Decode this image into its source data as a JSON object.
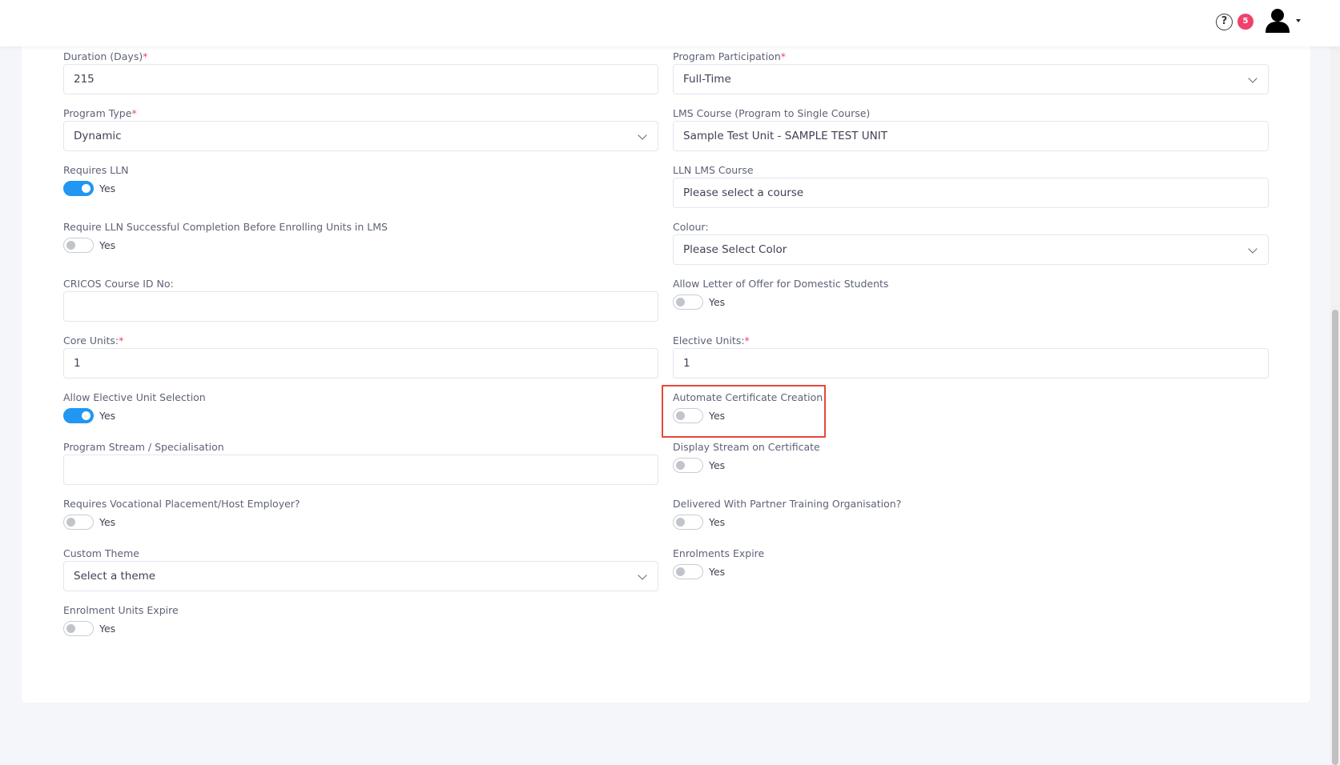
{
  "topbar": {
    "help_icon": "question-circle-icon",
    "notification_count": "5",
    "avatar_icon": "user-icon"
  },
  "form": {
    "duration": {
      "label": "Duration (Days)",
      "required": "*",
      "value": "215"
    },
    "program_participation": {
      "label": "Program Participation",
      "required": "*",
      "value": "Full-Time"
    },
    "program_type": {
      "label": "Program Type",
      "required": "*",
      "value": "Dynamic"
    },
    "lms_course": {
      "label": "LMS Course (Program to Single Course)",
      "value": "Sample Test Unit - SAMPLE TEST UNIT"
    },
    "requires_lln": {
      "label": "Requires LLN",
      "toggle_text": "Yes",
      "checked": true
    },
    "lln_lms_course": {
      "label": "LLN LMS Course",
      "placeholder": "Please select a course"
    },
    "require_lln_completion": {
      "label": "Require LLN Successful Completion Before Enrolling Units in LMS",
      "toggle_text": "Yes",
      "checked": false
    },
    "colour": {
      "label": "Colour:",
      "value": "Please Select Color"
    },
    "cricos_course_id": {
      "label": "CRICOS Course ID No:",
      "value": ""
    },
    "allow_letter_of_offer": {
      "label": "Allow Letter of Offer for Domestic Students",
      "toggle_text": "Yes",
      "checked": false
    },
    "core_units": {
      "label": "Core Units:",
      "required": "*",
      "value": "1"
    },
    "elective_units": {
      "label": "Elective Units:",
      "required": "*",
      "value": "1"
    },
    "allow_elective_selection": {
      "label": "Allow Elective Unit Selection",
      "toggle_text": "Yes",
      "checked": true
    },
    "automate_certificate": {
      "label": "Automate Certificate Creation",
      "toggle_text": "Yes",
      "checked": false
    },
    "program_stream": {
      "label": "Program Stream / Specialisation",
      "value": ""
    },
    "display_stream": {
      "label": "Display Stream on Certificate",
      "toggle_text": "Yes",
      "checked": false
    },
    "requires_placement": {
      "label": "Requires Vocational Placement/Host Employer?",
      "toggle_text": "Yes",
      "checked": false
    },
    "delivered_with_partner": {
      "label": "Delivered With Partner Training Organisation?",
      "toggle_text": "Yes",
      "checked": false
    },
    "custom_theme": {
      "label": "Custom Theme",
      "value": "Select a theme"
    },
    "enrolments_expire": {
      "label": "Enrolments Expire",
      "toggle_text": "Yes",
      "checked": false
    },
    "enrolment_units_expire": {
      "label": "Enrolment Units Expire",
      "toggle_text": "Yes",
      "checked": false
    }
  },
  "colors": {
    "accent": "#2196f3",
    "required": "#f1416c",
    "highlight": "#e5483c",
    "badge": "#f1416c"
  }
}
